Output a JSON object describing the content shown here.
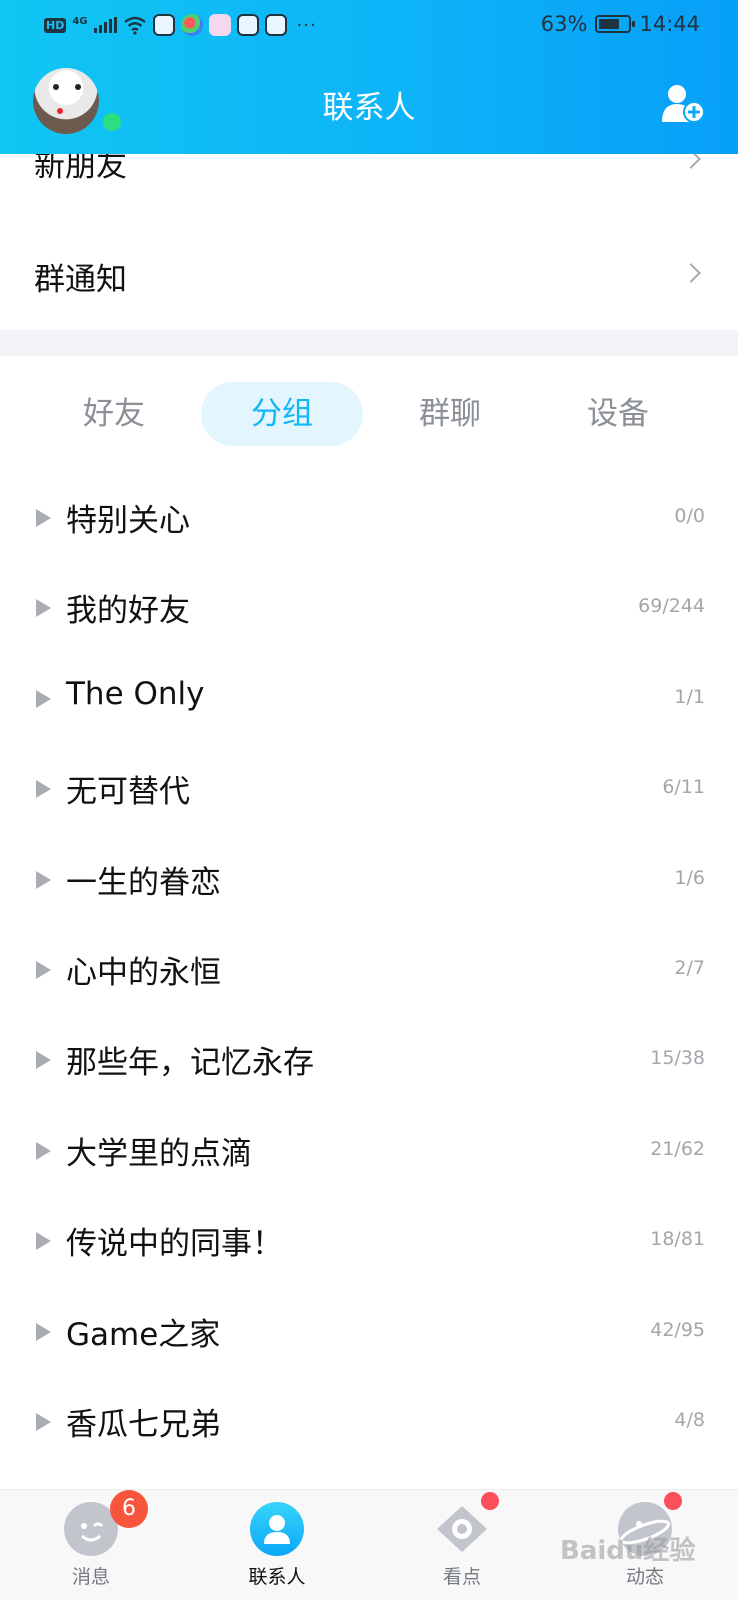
{
  "status_bar": {
    "hd": "HD",
    "network": "4G",
    "more": "···",
    "battery": "63%",
    "time": "14:44"
  },
  "header": {
    "title": "联系人"
  },
  "entries": [
    {
      "label": "新朋友"
    },
    {
      "label": "群通知"
    }
  ],
  "tabs": [
    {
      "label": "好友",
      "active": false
    },
    {
      "label": "分组",
      "active": true
    },
    {
      "label": "群聊",
      "active": false
    },
    {
      "label": "设备",
      "active": false
    }
  ],
  "groups": [
    {
      "name": "特别关心",
      "count": "0/0"
    },
    {
      "name": "我的好友",
      "count": "69/244"
    },
    {
      "name": "The Only",
      "count": "1/1"
    },
    {
      "name": "无可替代",
      "count": "6/11"
    },
    {
      "name": "一生的眷恋",
      "count": "1/6"
    },
    {
      "name": "心中的永恒",
      "count": "2/7"
    },
    {
      "name": "那些年，记忆永存",
      "count": "15/38"
    },
    {
      "name": "大学里的点滴",
      "count": "21/62"
    },
    {
      "name": "传说中的同事！",
      "count": "18/81"
    },
    {
      "name": "Game之家",
      "count": "42/95"
    },
    {
      "name": "香瓜七兄弟",
      "count": "4/8"
    }
  ],
  "nav": [
    {
      "label": "消息",
      "icon": "message-icon",
      "badge": "6"
    },
    {
      "label": "联系人",
      "icon": "contacts-icon",
      "active": true
    },
    {
      "label": "看点",
      "icon": "eye-icon",
      "dot": true
    },
    {
      "label": "动态",
      "icon": "planet-icon",
      "dot": true
    }
  ],
  "watermark": "Baidu经验",
  "colors": {
    "header_gradient_start": "#11c6f3",
    "header_gradient_end": "#079ff8",
    "accent": "#12b7f5",
    "tab_active_bg": "#e3f6fd",
    "badge": "#f8553c",
    "online": "#2bde7f"
  }
}
